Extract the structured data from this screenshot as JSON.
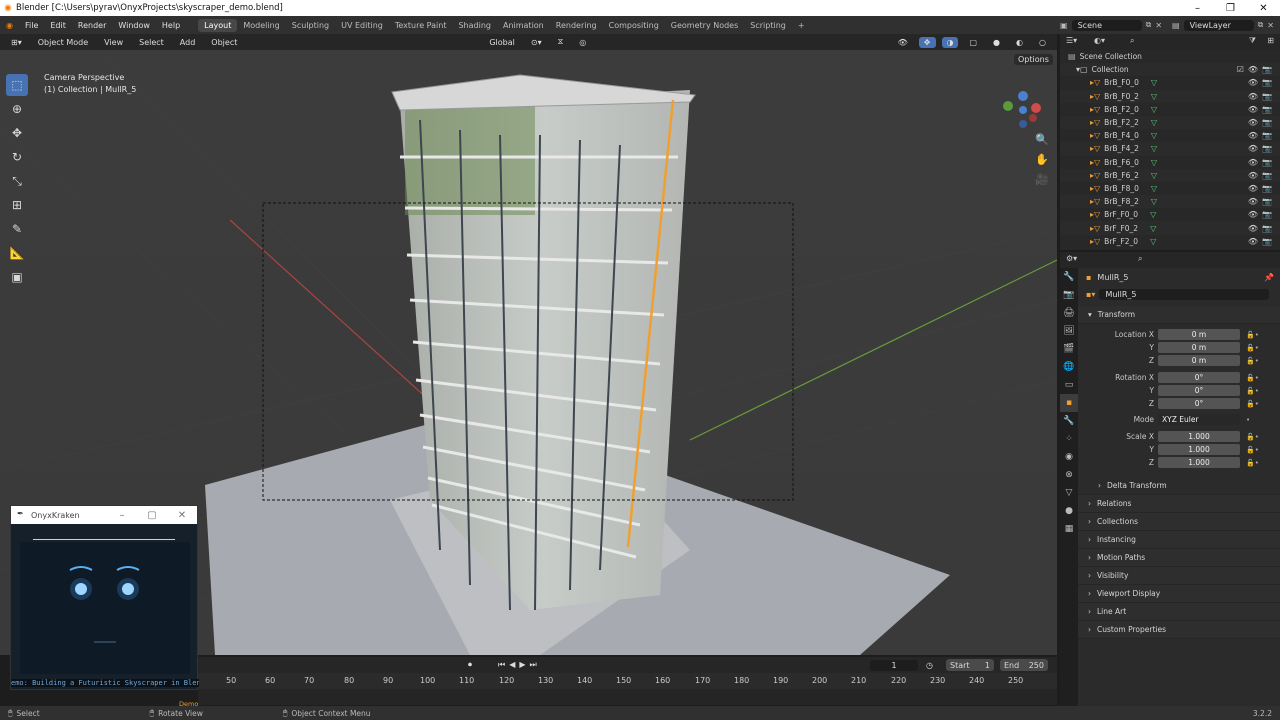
{
  "window": {
    "title": "Blender [C:\\Users\\pyrav\\OnyxProjects\\skyscraper_demo.blend]"
  },
  "menu": [
    "File",
    "Edit",
    "Render",
    "Window",
    "Help"
  ],
  "workspaces": [
    "Layout",
    "Modeling",
    "Sculpting",
    "UV Editing",
    "Texture Paint",
    "Shading",
    "Animation",
    "Rendering",
    "Compositing",
    "Geometry Nodes",
    "Scripting"
  ],
  "scene": "Scene",
  "view_layer": "ViewLayer",
  "viewport": {
    "mode": "Object Mode",
    "menus": [
      "View",
      "Select",
      "Add",
      "Object"
    ],
    "orientation": "Global",
    "options_label": "Options",
    "info_line1": "Camera Perspective",
    "info_line2": "(1) Collection | MullR_5"
  },
  "outliner": {
    "scene_collection": "Scene Collection",
    "collection": "Collection",
    "items": [
      "BrB_F0_0",
      "BrB_F0_2",
      "BrB_F2_0",
      "BrB_F2_2",
      "BrB_F4_0",
      "BrB_F4_2",
      "BrB_F6_0",
      "BrB_F6_2",
      "BrB_F8_0",
      "BrB_F8_2",
      "BrF_F0_0",
      "BrF_F0_2",
      "BrF_F2_0"
    ]
  },
  "properties": {
    "object_name": "MullR_5",
    "data_name": "MullR_5",
    "transform_label": "Transform",
    "location": {
      "label": "Location X",
      "x": "0 m",
      "y": "0 m",
      "z": "0 m"
    },
    "rotation": {
      "label": "Rotation X",
      "x": "0°",
      "y": "0°",
      "z": "0°"
    },
    "mode": {
      "label": "Mode",
      "value": "XYZ Euler"
    },
    "scale": {
      "label": "Scale X",
      "x": "1.000",
      "y": "1.000",
      "z": "1.000"
    },
    "axis_y": "Y",
    "axis_z": "Z",
    "delta": "Delta Transform",
    "panels": [
      "Relations",
      "Collections",
      "Instancing",
      "Motion Paths",
      "Visibility",
      "Viewport Display",
      "Line Art",
      "Custom Properties"
    ]
  },
  "timeline": {
    "current_frame": "1",
    "start_label": "Start",
    "start": "1",
    "end_label": "End",
    "end": "250",
    "ticks": [
      "50",
      "60",
      "70",
      "80",
      "90",
      "100",
      "110",
      "120",
      "130",
      "140",
      "150",
      "160",
      "170",
      "180",
      "190",
      "200",
      "210",
      "220",
      "230",
      "240",
      "250"
    ]
  },
  "status": {
    "left": "Select",
    "mid": "Rotate View",
    "context": "Object Context Menu",
    "version": "3.2.2"
  },
  "kraken": {
    "title": "OnyxKraken",
    "ticker": "emo: Building a Futuristic Skyscraper in Blender",
    "badge": "Demo"
  }
}
